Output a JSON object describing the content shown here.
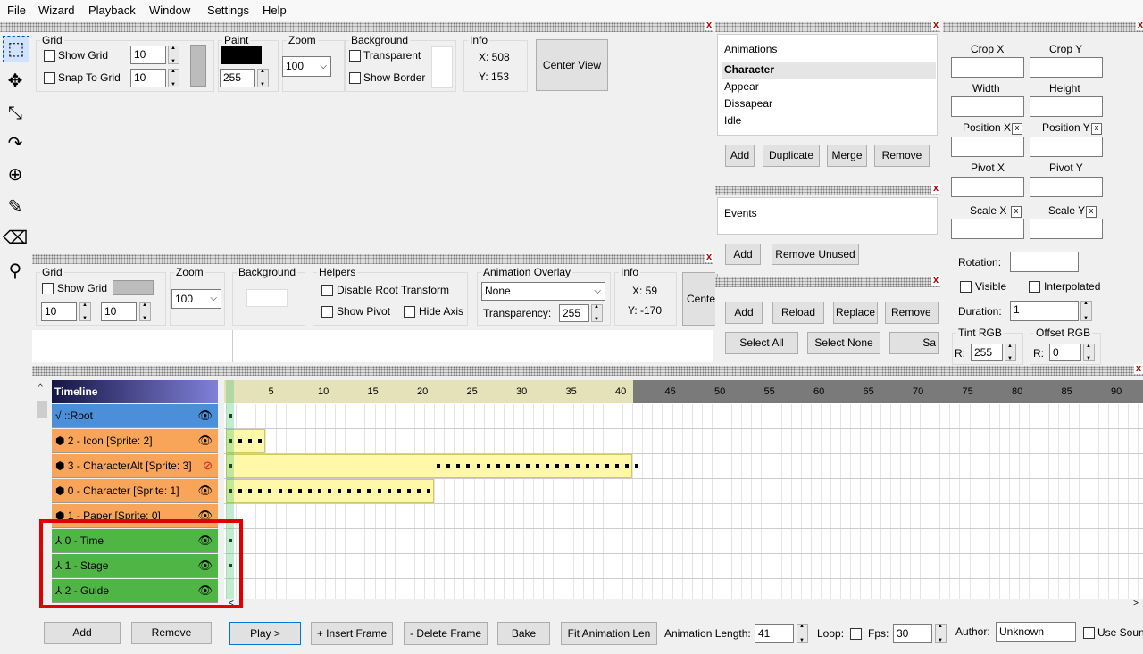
{
  "menu": [
    "File",
    "Wizard",
    "Playback",
    "Window",
    "Settings",
    "Help"
  ],
  "top_panel": {
    "grid_title": "Grid",
    "show_grid": "Show Grid",
    "snap_to_grid": "Snap To Grid",
    "grid_x": "10",
    "grid_y": "10",
    "paint_title": "Paint",
    "paint_alpha": "255",
    "zoom_title": "Zoom",
    "zoom_value": "100",
    "background_title": "Background",
    "transparent": "Transparent",
    "show_border": "Show Border",
    "info_title": "Info",
    "info_x": "X: 508",
    "info_y": "Y: 153",
    "center_view": "Center View"
  },
  "second_panel": {
    "grid_title": "Grid",
    "show_grid": "Show Grid",
    "grid_x": "10",
    "grid_y": "10",
    "zoom_title": "Zoom",
    "zoom_value": "100",
    "background_title": "Background",
    "helpers_title": "Helpers",
    "disable_root": "Disable Root Transform",
    "show_pivot": "Show Pivot",
    "hide_axis": "Hide Axis",
    "overlay_title": "Animation Overlay",
    "overlay_value": "None",
    "transparency_label": "Transparency:",
    "transparency_value": "255",
    "info_title": "Info",
    "info_x": "X: 59",
    "info_y": "Y: -170",
    "center": "Cente"
  },
  "animations": {
    "header": "Animations",
    "items": [
      "Character",
      "Appear",
      "Dissapear",
      "Idle"
    ],
    "add": "Add",
    "duplicate": "Duplicate",
    "merge": "Merge",
    "remove": "Remove"
  },
  "events": {
    "header": "Events",
    "add": "Add",
    "remove_unused": "Remove Unused"
  },
  "sprites": {
    "add": "Add",
    "reload": "Reload",
    "replace": "Replace",
    "remove": "Remove",
    "select_all": "Select All",
    "select_none": "Select None",
    "sa": "Sa"
  },
  "properties": {
    "crop_x": "Crop X",
    "crop_y": "Crop Y",
    "width": "Width",
    "height": "Height",
    "position_x": "Position X",
    "position_y": "Position Y",
    "pivot_x": "Pivot X",
    "pivot_y": "Pivot Y",
    "scale_x": "Scale X",
    "scale_y": "Scale Y",
    "rotation": "Rotation:",
    "visible": "Visible",
    "interpolated": "Interpolated",
    "duration": "Duration:",
    "duration_value": "1",
    "tint": "Tint RGB",
    "offset": "Offset RGB",
    "r1": "R:",
    "r1_value": "255",
    "r2": "R:",
    "r2_value": "0",
    "x_mark": "x"
  },
  "timeline": {
    "title": "Timeline",
    "rows": [
      {
        "label": "√ ::Root",
        "color": "#4a8fd8"
      },
      {
        "label": "⬢ 2 - Icon [Sprite: 2]",
        "color": "#f8a55a"
      },
      {
        "label": "⬢ 3 - CharacterAlt [Sprite: 3]",
        "color": "#f8a55a"
      },
      {
        "label": "⬢ 0 - Character [Sprite: 1]",
        "color": "#f8a55a"
      },
      {
        "label": "⬢ 1 - Paper [Sprite: 0]",
        "color": "#f8a55a"
      },
      {
        "label": "⅄ 0 - Time",
        "color": "#4fb545"
      },
      {
        "label": "⅄ 1 - Stage",
        "color": "#4fb545"
      },
      {
        "label": "⅄ 2 - Guide",
        "color": "#4fb545"
      }
    ],
    "ticks": [
      "5",
      "10",
      "15",
      "20",
      "25",
      "30",
      "35",
      "40",
      "45",
      "50",
      "55",
      "60",
      "65",
      "70",
      "75",
      "80",
      "85",
      "90"
    ],
    "add": "Add",
    "remove": "Remove"
  },
  "bottom_bar": {
    "play": "Play >",
    "insert": "+ Insert Frame",
    "delete": "- Delete Frame",
    "bake": "Bake",
    "fit": "Fit Animation Len",
    "length_label": "Animation Length:",
    "length_value": "41",
    "loop": "Loop:",
    "fps": "Fps:",
    "fps_value": "30",
    "author": "Author:",
    "author_value": "Unknown",
    "use_sound": "Use Soun"
  },
  "icons": {
    "eye": "👁",
    "hidden": "⊘"
  }
}
